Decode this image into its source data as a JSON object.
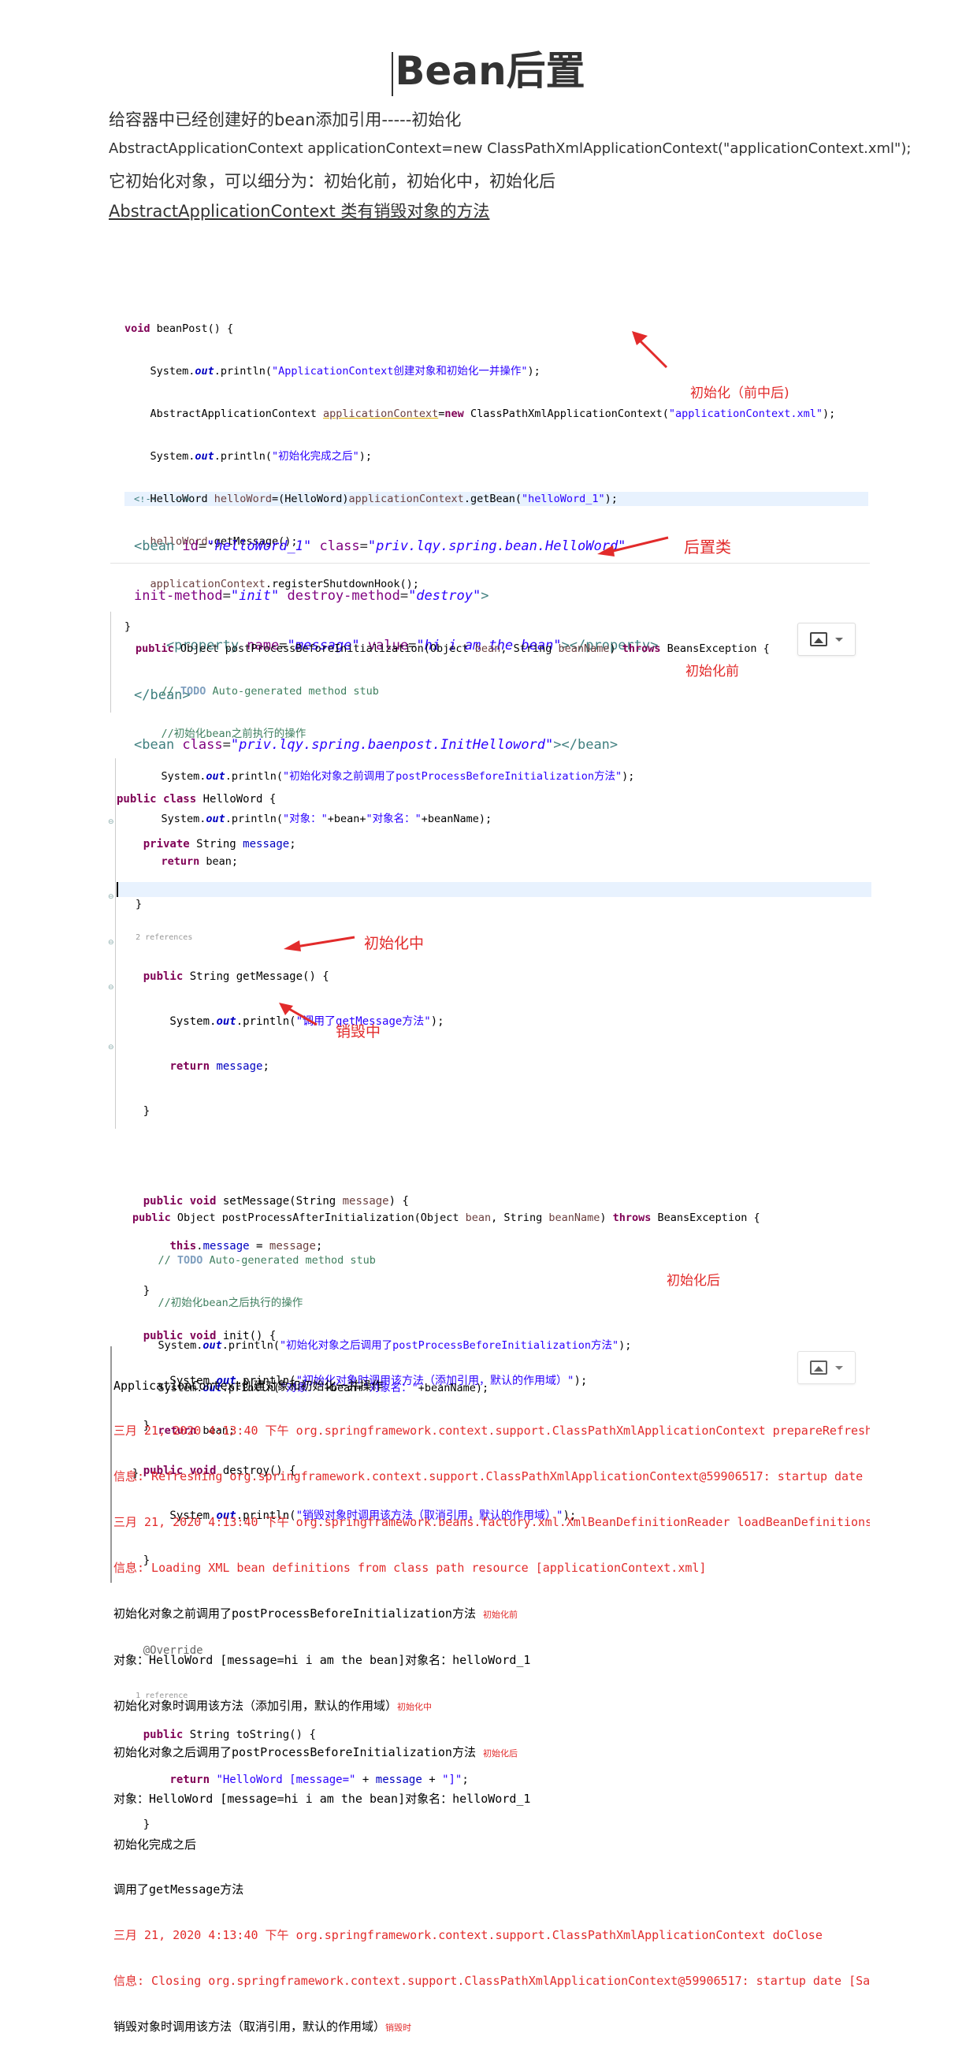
{
  "title": "Bean后置",
  "intro": {
    "line1": "给容器中已经创建好的bean添加引用-----初始化",
    "line2": "AbstractApplicationContext applicationContext=new ClassPathXmlApplicationContext(\"applicationContext.xml\");",
    "line3": "它初始化对象，可以细分为：初始化前，初始化中，初始化后",
    "line4": "AbstractApplicationContext 类有销毁对象的方法"
  },
  "panel1": {
    "l1_kw": "void",
    "l1": " beanPost() {",
    "l2a": "    System.",
    "l2_out": "out",
    "l2b": ".println(",
    "l2_str": "\"ApplicationContext创建对象和初始化一并操作\"",
    "l2c": ");",
    "l3a": "    AbstractApplicationContext ",
    "l3_var": "applicationContext",
    "l3b": "=",
    "l3_kw": "new",
    "l3c": " ClassPathXmlApplicationContext(",
    "l3_str": "\"applicationContext.xml\"",
    "l3d": ");",
    "l4a": "    System.",
    "l4_out": "out",
    "l4b": ".println(",
    "l4_str": "\"初始化完成之后\"",
    "l4c": ");",
    "l5a": "    HelloWord ",
    "l5_var": "helloWord",
    "l5b": "=(HelloWord)",
    "l5_var2": "applicationContext",
    "l5c": ".getBean(",
    "l5_str": "\"helloWord_1\"",
    "l5d": ");",
    "l6a": "    ",
    "l6_var": "helloWord",
    "l6b": ".getMessage();",
    "l7a": "    ",
    "l7_var": "applicationContext",
    "l7b": ".registerShutdownHook();",
    "l8": "}",
    "label": "初始化（前中后)"
  },
  "panel2": {
    "l0": "<!--   -->",
    "l1a": "<bean ",
    "l1_attr1": "id",
    "l1_val1": "\"helloWord_1\"",
    "l1_attr2": "class",
    "l1_val2": "\"priv.lqy.spring.bean.HelloWord\"",
    "l2_attr1": "init-method",
    "l2_val1": "\"init\"",
    "l2_attr2": "destroy-method",
    "l2_val2": "\"destroy\"",
    "l2b": ">",
    "l3a": "    <property ",
    "l3_attr1": "name",
    "l3_val1": "\"message\"",
    "l3_attr2": "value",
    "l3_val2": "\"hi i am the bean\"",
    "l3b": "></property>",
    "l4": "</bean>",
    "l5a": "<bean ",
    "l5_attr": "class",
    "l5_val": "\"priv.lqy.spring.baenpost.InitHelloword\"",
    "l5b": "></bean>",
    "label": "后置类"
  },
  "panel3": {
    "l1_kw1": "public",
    "l1a": " Object postProcessBeforeInitialization(Object ",
    "l1_var1": "bean",
    "l1b": ", String ",
    "l1_var2": "beanName",
    "l1c": ") ",
    "l1_kw2": "throws",
    "l1d": " BeansException {",
    "l2_c": "    // ",
    "l2_todo": "TODO",
    "l2_rest": " Auto-generated method stub",
    "l3": "    //初始化bean之前执行的操作",
    "l4a": "    System.",
    "l4_out": "out",
    "l4b": ".println(",
    "l4_str": "\"初始化对象之前调用了postProcessBeforeInitialization方法\"",
    "l4c": ");",
    "l5a": "    System.",
    "l5_out": "out",
    "l5b": ".println(",
    "l5_str1": "\"对象：\"",
    "l5c": "+bean+",
    "l5_str2": "\"对象名：\"",
    "l5d": "+beanName);",
    "l6_kw": "return",
    "l6": " bean;",
    "l7": "}",
    "label": "初始化前"
  },
  "panel4": {
    "l1_kw1": "public",
    "l1_kw2": "class",
    "l1": " HelloWord {",
    "l2_kw": "private",
    "l2a": " String ",
    "l2_fld": "message",
    "l2b": ";",
    "refs2": "2 references",
    "l4_kw": "public",
    "l4": " String getMessage() {",
    "l5a": "        System.",
    "l5_out": "out",
    "l5b": ".println(",
    "l5_str": "\"调用了getMessage方法\"",
    "l5c": ");",
    "l6_kw": "return",
    "l6_fld": "message",
    "l6b": ";",
    "l7": "    }",
    "l8_kw1": "public",
    "l8_kw2": "void",
    "l8a": " setMessage(String ",
    "l8_var": "message",
    "l8b": ") {",
    "l9_kw": "this",
    "l9_fld": "message",
    "l9a": " = ",
    "l9_var": "message",
    "l9b": ";",
    "l10": "    }",
    "l11_kw1": "public",
    "l11_kw2": "void",
    "l11": " init() {",
    "l12a": "        System.",
    "l12_out": "out",
    "l12b": ".println(",
    "l12_str": "\"初始化对象时调用该方法（添加引用，默认的作用域）\"",
    "l12c": ");",
    "l13": "    }",
    "l14_kw1": "public",
    "l14_kw2": "void",
    "l14": " destroy() {",
    "l15a": "        System.",
    "l15_out": "out",
    "l15b": ".println(",
    "l15_str": "\"销毁对象时调用该方法（取消引用，默认的作用域）\"",
    "l15c": ");",
    "l16": "    }",
    "l17_ann": "@Override",
    "refs1": "1 reference",
    "l18_kw": "public",
    "l18": " String toString() {",
    "l19_kw": "return",
    "l19_str1": "\"HelloWord [message=\"",
    "l19a": " + ",
    "l19_fld": "message",
    "l19b": " + ",
    "l19_str2": "\"]\"",
    "l19c": ";",
    "l20": "    }",
    "label_init": "初始化中",
    "label_destroy": "销毁中"
  },
  "panel5": {
    "l1_kw1": "public",
    "l1a": " Object postProcessAfterInitialization(Object ",
    "l1_var1": "bean",
    "l1b": ", String ",
    "l1_var2": "beanName",
    "l1c": ") ",
    "l1_kw2": "throws",
    "l1d": " BeansException {",
    "l2_c": "    // ",
    "l2_todo": "TODO",
    "l2_rest": " Auto-generated method stub",
    "l3": "    //初始化bean之后执行的操作",
    "l4a": "    System.",
    "l4_out": "out",
    "l4b": ".println(",
    "l4_str": "\"初始化对象之后调用了postProcessBeforeInitialization方法\"",
    "l4c": ");",
    "l5a": "    System.",
    "l5_out": "out",
    "l5b": ".println(",
    "l5_str1": "\"对象：\"",
    "l5c": "+bean+",
    "l5_str2": "\"对象名：\"",
    "l5d": "+beanName);",
    "l6_kw": "return",
    "l6": " bean;",
    "l7": "}",
    "label": "初始化后"
  },
  "console": {
    "c1": "ApplicationContext创建对象和初始化一并操作",
    "c2": "三月 21, 2020 4:13:40 下午 org.springframework.context.support.ClassPathXmlApplicationContext prepareRefresh",
    "c3": "信息: Refreshing org.springframework.context.support.ClassPathXmlApplicationContext@59906517: startup date [Sat",
    "c4": "三月 21, 2020 4:13:40 下午 org.springframework.beans.factory.xml.XmlBeanDefinitionReader loadBeanDefinitions",
    "c5": "信息: Loading XML bean definitions from class path resource [applicationContext.xml]",
    "c6": "初始化对象之前调用了postProcessBeforeInitialization方法",
    "c6_tag": "初始化前",
    "c7": "对象：HelloWord [message=hi i am the bean]对象名：helloWord_1",
    "c8": "初始化对象时调用该方法（添加引用，默认的作用域）",
    "c8_tag": "初始化中",
    "c9": "初始化对象之后调用了postProcessBeforeInitialization方法",
    "c9_tag": "初始化后",
    "c10": "对象：HelloWord [message=hi i am the bean]对象名：helloWord_1",
    "c11": "初始化完成之后",
    "c12": "调用了getMessage方法",
    "c13": "三月 21, 2020 4:13:40 下午 org.springframework.context.support.ClassPathXmlApplicationContext doClose",
    "c14": "信息: Closing org.springframework.context.support.ClassPathXmlApplicationContext@59906517: startup date [Sat Ma",
    "c15": "销毁对象时调用该方法（取消引用，默认的作用域）",
    "c15_tag": "销毁时"
  },
  "icons": {
    "image_button_1": "image-icon",
    "image_button_2": "image-icon",
    "dropdown": "chevron-down-icon"
  },
  "colors": {
    "keyword": "#7f0055",
    "string": "#2a00ff",
    "annotation_red": "#e22b2b",
    "comment": "#3f7f5f"
  }
}
